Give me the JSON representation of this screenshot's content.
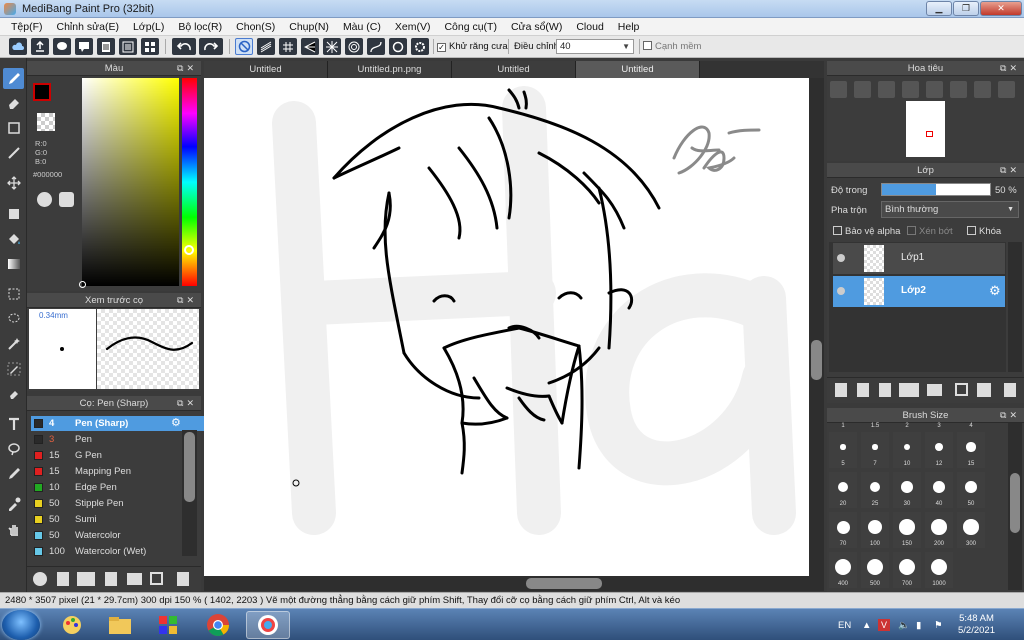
{
  "window": {
    "title": "MediBang Paint Pro (32bit)"
  },
  "menu": [
    "Tệp(F)",
    "Chỉnh sửa(E)",
    "Lớp(L)",
    "Bộ lọc(R)",
    "Chọn(S)",
    "Chụp(N)",
    "Màu (C)",
    "Xem(V)",
    "Công cụ(T)",
    "Cửa sổ(W)",
    "Cloud",
    "Help"
  ],
  "toolbar": {
    "antialias_label": "Khử răng cưa",
    "adjust_label": "Điều chỉnh",
    "adjust_value": "40",
    "edge_label": "Cạnh mềm"
  },
  "color_panel": {
    "title": "Màu",
    "r": "R:0",
    "g": "G:0",
    "b": "B:0",
    "hex": "#000000",
    "primary_color": "#cc0000"
  },
  "brush_preview": {
    "title": "Xem trước cọ",
    "size": "0.34mm"
  },
  "brush_panel": {
    "title": "Cọ: Pen (Sharp)",
    "items": [
      {
        "num": "4",
        "name": "Pen (Sharp)",
        "color": "#2a2a2a"
      },
      {
        "num": "3",
        "name": "Pen",
        "color": "#2a2a2a"
      },
      {
        "num": "15",
        "name": "G Pen",
        "color": "#e02020"
      },
      {
        "num": "15",
        "name": "Mapping Pen",
        "color": "#e02020"
      },
      {
        "num": "10",
        "name": "Edge Pen",
        "color": "#22aa22"
      },
      {
        "num": "50",
        "name": "Stipple Pen",
        "color": "#e8d020"
      },
      {
        "num": "50",
        "name": "Sumi",
        "color": "#e8d020"
      },
      {
        "num": "50",
        "name": "Watercolor",
        "color": "#66c8e8"
      },
      {
        "num": "100",
        "name": "Watercolor (Wet)",
        "color": "#66c8e8"
      }
    ]
  },
  "tabs": [
    "Untitled",
    "Untitled.pn.png",
    "Untitled",
    "Untitled"
  ],
  "navigator": {
    "title": "Hoa tiêu"
  },
  "layer_panel": {
    "title": "Lớp",
    "opacity_label": "Độ trong",
    "opacity_value": "50 %",
    "opacity_fraction": 0.5,
    "blend_label": "Pha trộn",
    "blend_value": "Bình thường",
    "protect_alpha": "Bảo vệ alpha",
    "clipping": "Xén bớt",
    "lock": "Khóa",
    "layers": [
      {
        "name": "Lớp1"
      },
      {
        "name": "Lớp2"
      }
    ]
  },
  "brush_size_panel": {
    "title": "Brush Size",
    "top_row": [
      "1",
      "1.5",
      "2",
      "3",
      "4"
    ],
    "sizes": [
      "5",
      "7",
      "10",
      "12",
      "15",
      "20",
      "25",
      "30",
      "40",
      "50",
      "70",
      "100",
      "150",
      "200",
      "300",
      "400",
      "500",
      "700",
      "1000"
    ]
  },
  "statusbar": {
    "text": "2480 * 3507 pixel   (21 * 29.7cm)   300 dpi   150 %   ( 1402, 2203 )   Vẽ một đường thẳng bằng cách giữ phím Shift, Thay đổi cỡ cọ bằng cách giữ phím Ctrl, Alt và kéo"
  },
  "taskbar": {
    "lang": "EN",
    "time": "5:48 AM",
    "date": "5/2/2021"
  }
}
